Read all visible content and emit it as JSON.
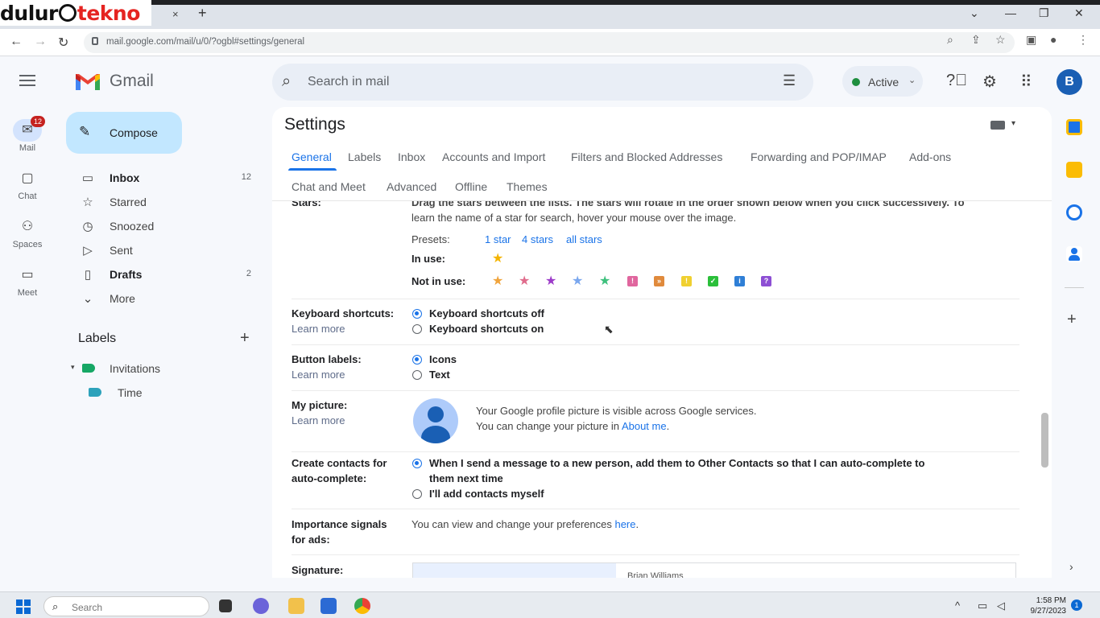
{
  "watermark": {
    "part1": "dulur",
    "part2": "tekno"
  },
  "browser": {
    "url": "mail.google.com/mail/u/0/?ogbl#settings/general",
    "tab_close": "×",
    "new_tab": "+",
    "min": "⌄",
    "minimize": "—",
    "restore": "❐",
    "close": "✕"
  },
  "gmail": {
    "app_name": "Gmail",
    "search_placeholder": "Search in mail",
    "status": "Active",
    "avatar_letter": "B"
  },
  "rail": [
    {
      "label": "Mail",
      "badge": "12"
    },
    {
      "label": "Chat"
    },
    {
      "label": "Spaces"
    },
    {
      "label": "Meet"
    }
  ],
  "nav": {
    "compose": "Compose",
    "items": [
      {
        "label": "Inbox",
        "count": "12"
      },
      {
        "label": "Starred",
        "count": ""
      },
      {
        "label": "Snoozed",
        "count": ""
      },
      {
        "label": "Sent",
        "count": ""
      },
      {
        "label": "Drafts",
        "count": "2"
      },
      {
        "label": "More",
        "count": ""
      }
    ],
    "labels_header": "Labels",
    "labels": [
      {
        "label": "Invitations"
      },
      {
        "label": "Time"
      }
    ]
  },
  "settings": {
    "title": "Settings",
    "tabs": [
      "General",
      "Labels",
      "Inbox",
      "Accounts and Import",
      "Filters and Blocked Addresses",
      "Forwarding and POP/IMAP",
      "Add-ons",
      "Chat and Meet",
      "Advanced",
      "Offline",
      "Themes"
    ],
    "stars": {
      "title": "Stars:",
      "desc1": "Drag the stars between the lists.  The stars will rotate in the order shown below when you click successively. To",
      "desc2": "learn the name of a star for search, hover your mouse over the image.",
      "presets_label": "Presets:",
      "presets": [
        "1 star",
        "4 stars",
        "all stars"
      ],
      "in_use_label": "In use:",
      "not_in_use_label": "Not in use:"
    },
    "keyboard": {
      "title": "Keyboard shortcuts:",
      "learn_more": "Learn more",
      "options": [
        "Keyboard shortcuts off",
        "Keyboard shortcuts on"
      ]
    },
    "button_labels": {
      "title": "Button labels:",
      "learn_more": "Learn more",
      "options": [
        "Icons",
        "Text"
      ]
    },
    "my_picture": {
      "title": "My picture:",
      "learn_more": "Learn more",
      "line1": "Your Google profile picture is visible across Google services.",
      "line2_prefix": "You can change your picture in ",
      "line2_link": "About me",
      "line2_suffix": "."
    },
    "contacts": {
      "title1": "Create contacts for",
      "title2": "auto-complete:",
      "option1_a": "When I send a message to a new person, add them to Other Contacts so that I can auto-complete to",
      "option1_b": "them next time",
      "option2": "I'll add contacts myself"
    },
    "importance": {
      "title1": "Importance signals",
      "title2": "for ads:",
      "text_prefix": "You can view and change your preferences ",
      "text_link": "here",
      "text_suffix": "."
    },
    "signature": {
      "title": "Signature:",
      "name": "Brian Williams"
    }
  },
  "taskbar": {
    "search_placeholder": "Search",
    "time": "1:58 PM",
    "date": "9/27/2023",
    "notifications": "1"
  },
  "colors": {
    "accent": "#1a73e8",
    "compose_bg": "#c2e7ff",
    "avatar": "#1a5fb4",
    "active_dot": "#1e8e3e",
    "badge": "#c5221f"
  }
}
